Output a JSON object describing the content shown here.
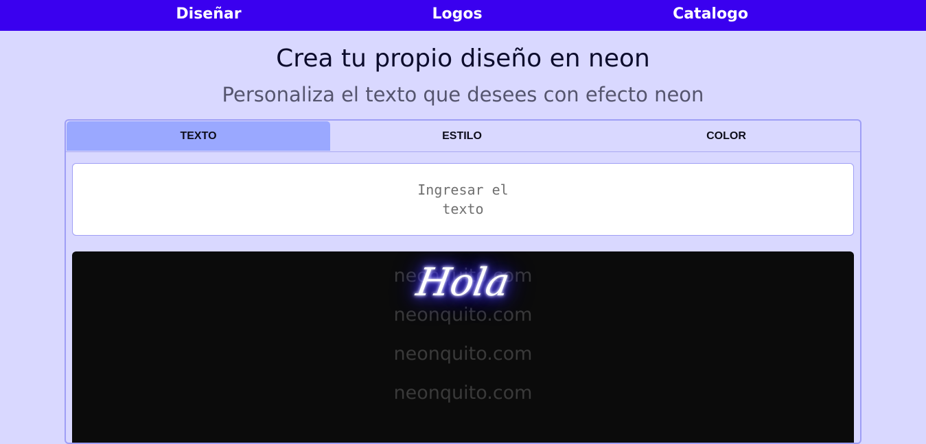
{
  "nav": {
    "items": [
      "Diseñar",
      "Logos",
      "Catalogo"
    ]
  },
  "page": {
    "title": "Crea tu propio diseño en neon",
    "subtitle": "Personaliza el texto que desees con efecto neon"
  },
  "tabs": [
    {
      "label": "TEXTO",
      "active": true
    },
    {
      "label": "ESTILO",
      "active": false
    },
    {
      "label": "COLOR",
      "active": false
    }
  ],
  "text_input": {
    "placeholder": "Ingresar el texto"
  },
  "preview": {
    "neon_text": "Hola",
    "neon_color": "#3a2cff",
    "watermark": "neonquito.com"
  },
  "colors": {
    "nav_background": "#3a00ef",
    "page_background": "#d9d8ff",
    "active_tab": "#9aa8ff"
  }
}
